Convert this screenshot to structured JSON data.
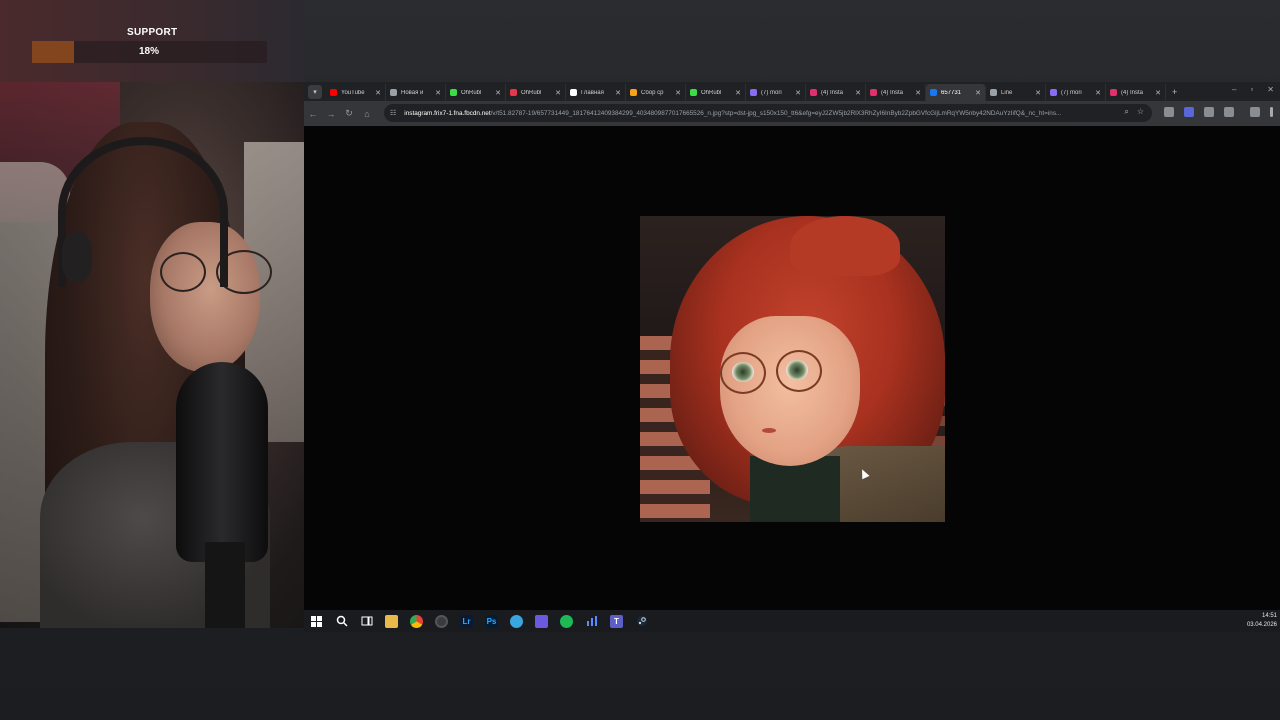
{
  "overlay": {
    "support_title": "SUPPORT",
    "support_percent": "18%",
    "support_progress": 0.18,
    "accent_color": "#c8651a"
  },
  "browser": {
    "tab_menu_icon": "chevron-down-icon",
    "tabs": [
      {
        "label": "YouTube",
        "favicon_color": "#ff0000",
        "active": false
      },
      {
        "label": "Новая и",
        "favicon_color": "#9aa0a6",
        "active": false
      },
      {
        "label": "OhRubl",
        "favicon_color": "#3ddc49",
        "active": false
      },
      {
        "label": "OhRubl",
        "favicon_color": "#e8364a",
        "active": false
      },
      {
        "label": "Главная",
        "favicon_color": "#ffffff",
        "active": false
      },
      {
        "label": "Сбор ср",
        "favicon_color": "#f7a21b",
        "active": false
      },
      {
        "label": "OhRubl",
        "favicon_color": "#3ddc49",
        "active": false
      },
      {
        "label": "(7) mori",
        "favicon_color": "#8a6cf0",
        "active": false
      },
      {
        "label": "(4) Insta",
        "favicon_color": "#e1306c",
        "active": false
      },
      {
        "label": "(4) Insta",
        "favicon_color": "#e1306c",
        "active": false
      },
      {
        "label": "657731",
        "favicon_color": "#1877f2",
        "active": true
      },
      {
        "label": "Line",
        "favicon_color": "#9aa0a6",
        "active": false
      },
      {
        "label": "(7) mori",
        "favicon_color": "#8a6cf0",
        "active": false
      },
      {
        "label": "(4) Insta",
        "favicon_color": "#e1306c",
        "active": false
      }
    ],
    "new_tab_label": "+",
    "url_host": "instagram.frix7-1.fna.fbcdn.net",
    "url_path": "/v/t51.82787-19/657731449_18176412409384299_4034809877017665526_n.jpg?stp=dst-jpg_s150x150_tt6&efg=eyJ2ZW5jb2RlX3RhZyI6InByb2ZpbGVfcGljLmRqYW5nby42NDAuYzIifQ&_nc_ht=ins..."
  },
  "taskbar": {
    "icons": [
      "windows-start-icon",
      "search-icon",
      "task-view-icon",
      "file-explorer-icon",
      "chrome-icon",
      "obs-icon",
      "lightroom-icon",
      "photoshop-icon",
      "browser-icon",
      "app-grid-icon",
      "spotify-icon",
      "stats-icon",
      "twitch-icon",
      "steam-icon"
    ],
    "icon_labels": {
      "lightroom": "Lr",
      "photoshop": "Ps",
      "twitch": "T"
    },
    "time": "14:51",
    "date": "03.04.2026"
  }
}
